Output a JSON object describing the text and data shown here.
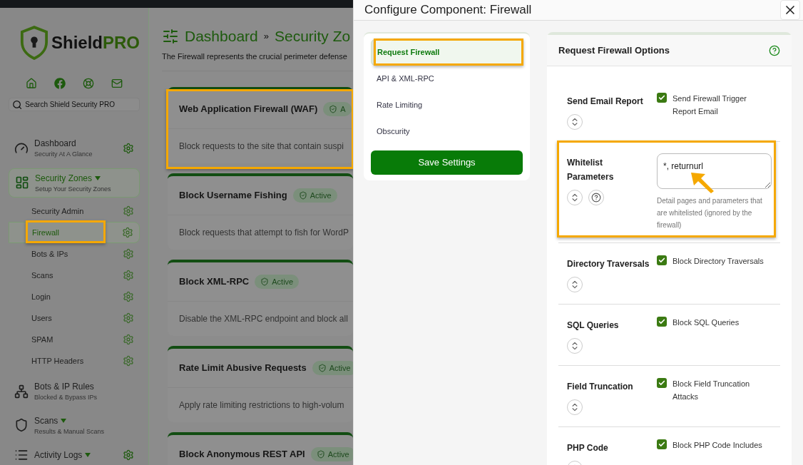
{
  "sidebar": {
    "logo": {
      "word": "Shield",
      "accent": "PRO"
    },
    "search": {
      "placeholder": "Search Shield Security PRO"
    },
    "nav": [
      {
        "title": "Dashboard",
        "subtitle": "Security At A Glance",
        "caret": false,
        "gear": true,
        "selected": false
      },
      {
        "title": "Security Zones",
        "subtitle": "Setup Your Security Zones",
        "caret": true,
        "gear": false,
        "selected": true,
        "children": [
          {
            "label": "Security Admin",
            "selected": false,
            "highlighted": false
          },
          {
            "label": "Firewall",
            "selected": true,
            "highlighted": true
          },
          {
            "label": "Bots & IPs",
            "selected": false,
            "highlighted": false
          },
          {
            "label": "Scans",
            "selected": false,
            "highlighted": false
          },
          {
            "label": "Login",
            "selected": false,
            "highlighted": false
          },
          {
            "label": "Users",
            "selected": false,
            "highlighted": false
          },
          {
            "label": "SPAM",
            "selected": false,
            "highlighted": false
          },
          {
            "label": "HTTP Headers",
            "selected": false,
            "highlighted": false
          }
        ]
      },
      {
        "title": "Bots & IP Rules",
        "subtitle": "Blocked & Bypass IPs",
        "caret": false,
        "gear": false,
        "selected": false
      },
      {
        "title": "Scans",
        "subtitle": "Results & Manual Scans",
        "caret": true,
        "gear": false,
        "selected": false
      },
      {
        "title": "Activity Logs",
        "caret": true,
        "gear": true,
        "selected": false
      }
    ]
  },
  "main": {
    "breadcrumb": [
      "Dashboard",
      "Security Zo"
    ],
    "separator": "»",
    "intro": "The Firewall represents the crucial perimeter defense",
    "cards": [
      {
        "title": "Web Application Firewall (WAF)",
        "badge": "A",
        "description": "Block requests to the site that contain suspi",
        "highlighted": true
      },
      {
        "title": "Block Username Fishing",
        "badge": "Active",
        "description": "Block requests that attempt to fish for WordP",
        "highlighted": false
      },
      {
        "title": "Block XML-RPC",
        "badge": "Active",
        "description": "Disable the XML-RPC endpoint and block all",
        "highlighted": false
      },
      {
        "title": "Rate Limit Abusive Requests",
        "badge": "Active",
        "description": "Apply rate limiting restrictions to high-volum",
        "highlighted": false
      },
      {
        "title": "Block Anonymous REST API",
        "badge": "Active",
        "highlighted": false
      }
    ]
  },
  "modal": {
    "title": "Configure Component: Firewall",
    "nav": [
      {
        "label": "Request Firewall",
        "selected": true,
        "highlighted": true
      },
      {
        "label": "API & XML-RPC",
        "selected": false,
        "highlighted": false
      },
      {
        "label": "Rate Limiting",
        "selected": false,
        "highlighted": false
      },
      {
        "label": "Obscurity",
        "selected": false,
        "highlighted": false
      }
    ],
    "save_button": "Save Settings",
    "panel": {
      "title": "Request Firewall Options",
      "options": [
        {
          "kind": "checkbox",
          "label": "Send Email Report",
          "checked": true,
          "text": "Send Firewall Trigger Report Email",
          "help": false,
          "highlighted": false
        },
        {
          "kind": "textarea",
          "label": "Whitelist Parameters",
          "value": "*, returnurl",
          "hint": "Detail pages and parameters that are whitelisted (ignored by the firewall)",
          "help": true,
          "highlighted": true,
          "pointer": true
        },
        {
          "kind": "checkbox",
          "label": "Directory Traversals",
          "checked": true,
          "text": "Block Directory Traversals",
          "help": false,
          "highlighted": false
        },
        {
          "kind": "checkbox",
          "label": "SQL Queries",
          "checked": true,
          "text": "Block SQL Queries",
          "help": false,
          "highlighted": false
        },
        {
          "kind": "checkbox",
          "label": "Field Truncation",
          "checked": true,
          "text": "Block Field Truncation Attacks",
          "help": false,
          "highlighted": false
        },
        {
          "kind": "checkbox",
          "label": "PHP Code",
          "checked": true,
          "text": "Block PHP Code Includes",
          "help": false,
          "highlighted": false
        }
      ]
    }
  }
}
